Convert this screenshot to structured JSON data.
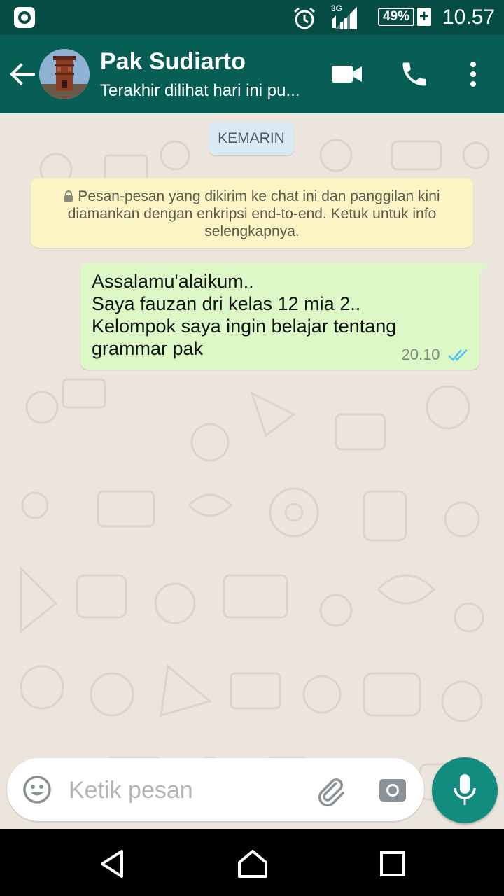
{
  "status_bar": {
    "network": "3G",
    "battery": "49%",
    "charging_symbol": "+",
    "time": "10.57",
    "icons": [
      "screen-recorder-icon",
      "alarm-icon",
      "signal-icon",
      "battery-icon",
      "charging-icon"
    ]
  },
  "header": {
    "contact_name": "Pak Sudiarto",
    "last_seen": "Terakhir dilihat hari ini pu...",
    "icons": [
      "back-arrow-icon",
      "video-call-icon",
      "phone-icon",
      "more-vert-icon"
    ],
    "color": "#075e54"
  },
  "chat": {
    "date_chip": "KEMARIN",
    "encryption_notice": "Pesan-pesan yang dikirim ke chat ini dan panggilan kini diamankan dengan enkripsi end-to-end. Ketuk untuk info selengkapnya.",
    "messages": [
      {
        "direction": "outgoing",
        "lines": [
          "Assalamu'alaikum..",
          "Saya fauzan dri kelas 12 mia 2..",
          "Kelompok saya ingin belajar tentang",
          "grammar pak"
        ],
        "time": "20.10",
        "status": "read",
        "bubble_color": "#dcf8c6",
        "tick_color": "#4fc3f7"
      }
    ]
  },
  "composer": {
    "placeholder": "Ketik pesan",
    "value": "",
    "icons": [
      "emoji-icon",
      "attach-icon",
      "camera-icon",
      "mic-icon"
    ],
    "mic_color": "#128c7e"
  },
  "nav_bar": {
    "icons": [
      "nav-back-icon",
      "nav-home-icon",
      "nav-recents-icon"
    ]
  }
}
